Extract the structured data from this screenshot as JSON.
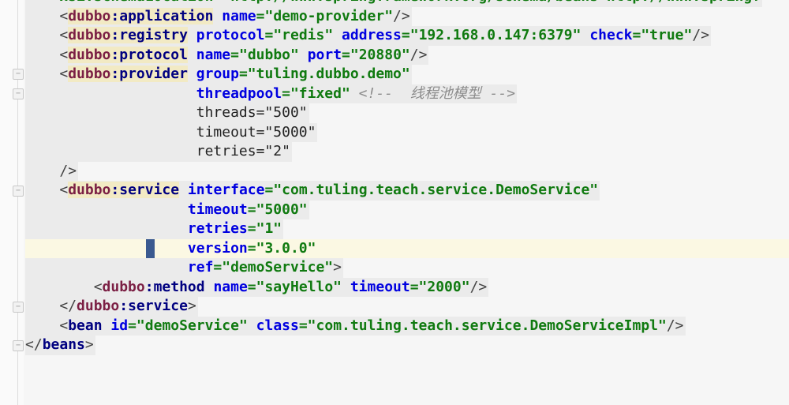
{
  "editor": {
    "lines": [
      [
        {
          "t": "    xsi:schemaLocation=\"http://www.springframework.org/schema/beans http://www.springf",
          "c": "v"
        }
      ],
      [
        {
          "t": "    ",
          "c": "pl"
        },
        {
          "t": "<",
          "c": "br"
        },
        {
          "t": "dubbo",
          "c": "ns",
          "h": 1
        },
        {
          "t": ":application",
          "c": "tg",
          "h": 1
        },
        {
          "t": " ",
          "c": "pl"
        },
        {
          "t": "name",
          "c": "at"
        },
        {
          "t": "=\"demo-provider\"",
          "c": "v"
        },
        {
          "t": "/>",
          "c": "br"
        }
      ],
      [
        {
          "t": "    ",
          "c": "pl"
        },
        {
          "t": "<",
          "c": "br"
        },
        {
          "t": "dubbo",
          "c": "ns",
          "h": 1
        },
        {
          "t": ":registry",
          "c": "tg",
          "h": 1
        },
        {
          "t": " ",
          "c": "pl"
        },
        {
          "t": "protocol",
          "c": "at"
        },
        {
          "t": "=\"redis\" ",
          "c": "v"
        },
        {
          "t": "address",
          "c": "at"
        },
        {
          "t": "=\"192.168.0.147:6379\" ",
          "c": "v"
        },
        {
          "t": "check",
          "c": "at"
        },
        {
          "t": "=\"true\"",
          "c": "v"
        },
        {
          "t": "/>",
          "c": "br"
        }
      ],
      [
        {
          "t": "    ",
          "c": "pl"
        },
        {
          "t": "<",
          "c": "br"
        },
        {
          "t": "dubbo",
          "c": "ns",
          "h": 1
        },
        {
          "t": ":protocol",
          "c": "tg",
          "h": 1
        },
        {
          "t": " ",
          "c": "pl"
        },
        {
          "t": "name",
          "c": "at"
        },
        {
          "t": "=\"dubbo\" ",
          "c": "v"
        },
        {
          "t": "port",
          "c": "at"
        },
        {
          "t": "=\"20880\"",
          "c": "v"
        },
        {
          "t": "/>",
          "c": "br"
        }
      ],
      [
        {
          "t": "    ",
          "c": "pl"
        },
        {
          "t": "<",
          "c": "br"
        },
        {
          "t": "dubbo",
          "c": "ns",
          "h": 1
        },
        {
          "t": ":provider",
          "c": "tg",
          "h": 1
        },
        {
          "t": " ",
          "c": "pl"
        },
        {
          "t": "group",
          "c": "at"
        },
        {
          "t": "=\"tuling.dubbo.demo\"",
          "c": "v"
        }
      ],
      [
        {
          "t": "                    ",
          "c": "pl"
        },
        {
          "t": "threadpool",
          "c": "at"
        },
        {
          "t": "=\"fixed\" ",
          "c": "v"
        },
        {
          "t": "<!--  线程池模型 -->",
          "c": "cm"
        }
      ],
      [
        {
          "t": "                    ",
          "c": "pl"
        },
        {
          "t": "threads=\"500\"",
          "c": "pl"
        }
      ],
      [
        {
          "t": "                    ",
          "c": "pl"
        },
        {
          "t": "timeout=\"5000\"",
          "c": "pl"
        }
      ],
      [
        {
          "t": "                    ",
          "c": "pl"
        },
        {
          "t": "retries=\"2\"",
          "c": "pl"
        }
      ],
      [
        {
          "t": "    ",
          "c": "pl"
        },
        {
          "t": "/>",
          "c": "br"
        }
      ],
      [
        {
          "t": "    ",
          "c": "pl"
        },
        {
          "t": "<",
          "c": "br"
        },
        {
          "t": "dubbo",
          "c": "ns",
          "h": 1
        },
        {
          "t": ":service",
          "c": "tg",
          "h": 1
        },
        {
          "t": " ",
          "c": "pl"
        },
        {
          "t": "interface",
          "c": "at"
        },
        {
          "t": "=\"com.tuling.teach.service.DemoService\"",
          "c": "v"
        }
      ],
      [
        {
          "t": "                   ",
          "c": "pl"
        },
        {
          "t": "timeout",
          "c": "at"
        },
        {
          "t": "=\"5000\"",
          "c": "v"
        }
      ],
      [
        {
          "t": "                   ",
          "c": "pl"
        },
        {
          "t": "retries",
          "c": "at"
        },
        {
          "t": "=\"1\"",
          "c": "v"
        }
      ],
      [
        {
          "t": "                   ",
          "c": "pl"
        },
        {
          "t": "version",
          "c": "at"
        },
        {
          "t": "=\"3.0.0\"",
          "c": "v"
        }
      ],
      [
        {
          "t": "                   ",
          "c": "pl"
        },
        {
          "t": "ref",
          "c": "at"
        },
        {
          "t": "=\"demoService\"",
          "c": "v"
        },
        {
          "t": ">",
          "c": "br"
        }
      ],
      [
        {
          "t": "        ",
          "c": "pl"
        },
        {
          "t": "<",
          "c": "br"
        },
        {
          "t": "dubbo",
          "c": "ns"
        },
        {
          "t": ":method",
          "c": "tg"
        },
        {
          "t": " ",
          "c": "pl"
        },
        {
          "t": "name",
          "c": "at"
        },
        {
          "t": "=\"sayHello\" ",
          "c": "v"
        },
        {
          "t": "timeout",
          "c": "at"
        },
        {
          "t": "=\"2000\"",
          "c": "v"
        },
        {
          "t": "/>",
          "c": "br"
        }
      ],
      [
        {
          "t": "    ",
          "c": "pl"
        },
        {
          "t": "</",
          "c": "br"
        },
        {
          "t": "dubbo",
          "c": "ns"
        },
        {
          "t": ":service",
          "c": "tg"
        },
        {
          "t": ">",
          "c": "br"
        }
      ],
      [
        {
          "t": "    ",
          "c": "pl"
        },
        {
          "t": "<",
          "c": "br"
        },
        {
          "t": "bean",
          "c": "tg"
        },
        {
          "t": " ",
          "c": "pl"
        },
        {
          "t": "id",
          "c": "at"
        },
        {
          "t": "=\"demoService\" ",
          "c": "v"
        },
        {
          "t": "class",
          "c": "at"
        },
        {
          "t": "=\"com.tuling.teach.service.DemoServiceImpl\"",
          "c": "v"
        },
        {
          "t": "/>",
          "c": "br"
        }
      ],
      [
        {
          "t": "</",
          "c": "br"
        },
        {
          "t": "beans",
          "c": "tg"
        },
        {
          "t": ">",
          "c": "br"
        }
      ]
    ],
    "current_line": 13,
    "fold_markers": [
      "fold-icon",
      "fold-icon",
      "fold-icon",
      "fold-icon",
      "fold-icon"
    ]
  }
}
